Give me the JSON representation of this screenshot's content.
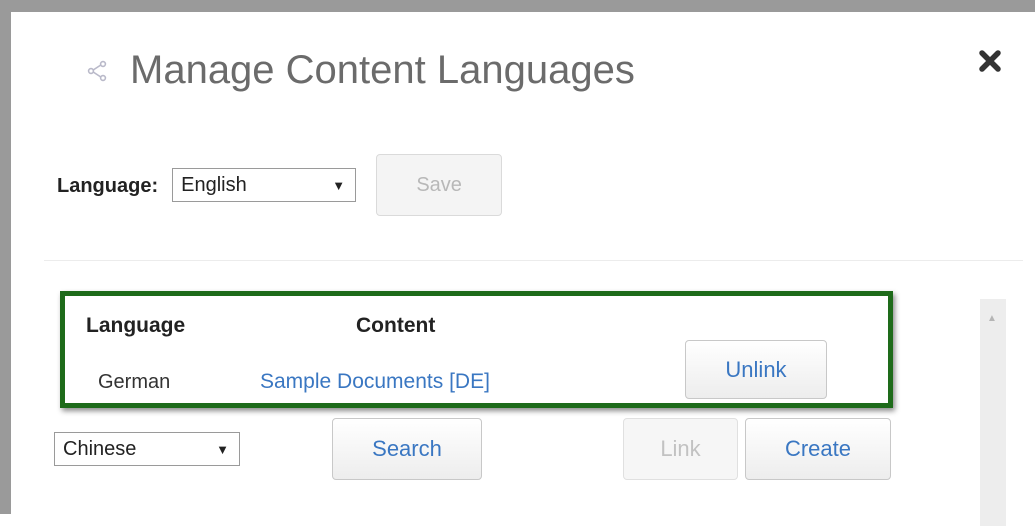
{
  "dialog": {
    "title": "Manage Content Languages",
    "icons": {
      "title": "share-icon",
      "close": "close-icon"
    }
  },
  "language_selector": {
    "label": "Language:",
    "selected": "English",
    "save_label": "Save",
    "save_disabled": true
  },
  "table": {
    "headers": {
      "language": "Language",
      "content": "Content"
    },
    "rows": [
      {
        "language": "German",
        "content": "Sample Documents [DE]",
        "action": "Unlink"
      }
    ],
    "highlight_color": "#1e6b1a"
  },
  "new_link": {
    "selected_language": "Chinese",
    "search_label": "Search",
    "link_label": "Link",
    "link_disabled": true,
    "create_label": "Create"
  },
  "colors": {
    "link": "#3a77c2",
    "title": "#6b6b6b"
  }
}
